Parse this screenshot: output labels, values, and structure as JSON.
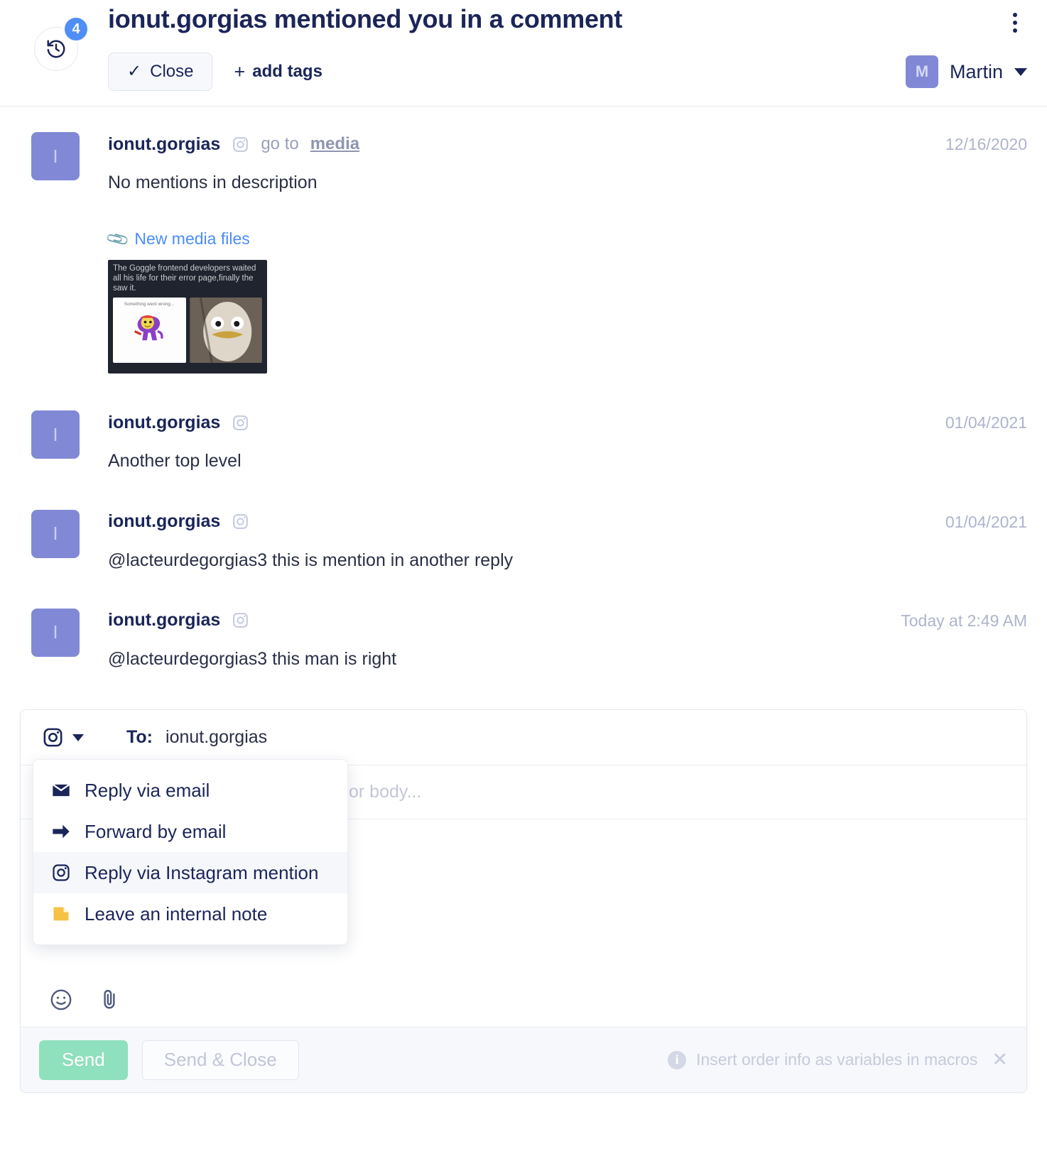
{
  "header": {
    "title": "ionut.gorgias mentioned you in a comment",
    "history_badge": "4",
    "history_icon": "history-clock-icon",
    "close_label": "Close",
    "close_check": "✓",
    "add_tags_label": "add tags",
    "add_tags_plus": "+",
    "kebab_icon": "more-vertical-icon",
    "user": {
      "initial": "M",
      "name": "Martin"
    }
  },
  "thread": {
    "messages": [
      {
        "avatar_initial": "I",
        "author": "ionut.gorgias",
        "channel_icon": "instagram-icon",
        "goto_prefix": "go to",
        "goto_link": "media",
        "time": "12/16/2020",
        "text": "No mentions in description",
        "attachment": {
          "label": "New media files",
          "icon": "paperclip-icon",
          "caption": "The Goggle frontend developers waited all his life for their error page,finally the saw it.",
          "left_pane_caption": "Something went wrong..."
        }
      },
      {
        "avatar_initial": "I",
        "author": "ionut.gorgias",
        "channel_icon": "instagram-icon",
        "time": "01/04/2021",
        "text": "Another top level"
      },
      {
        "avatar_initial": "I",
        "author": "ionut.gorgias",
        "channel_icon": "instagram-icon",
        "time": "01/04/2021",
        "text": "@lacteurdegorgias3 this is mention in another reply"
      },
      {
        "avatar_initial": "I",
        "author": "ionut.gorgias",
        "channel_icon": "instagram-icon",
        "time": "Today at 2:49 AM",
        "text": "@lacteurdegorgias3 this man is right"
      }
    ]
  },
  "composer": {
    "channel_icon": "instagram-icon",
    "to_label": "To:",
    "to_value": "ionut.gorgias",
    "subject_placeholder": "or body...",
    "emoji_icon": "emoji-smile-icon",
    "attach_icon": "paperclip-icon",
    "send_label": "Send",
    "send_close_label": "Send & Close",
    "footer_note": "Insert order info as variables in macros",
    "footer_note_icon": "info-icon",
    "footer_close_icon": "close-x-icon"
  },
  "dropdown": {
    "items": [
      {
        "label": "Reply via email",
        "icon": "envelope-icon",
        "selected": false
      },
      {
        "label": "Forward by email",
        "icon": "arrow-right-icon",
        "selected": false
      },
      {
        "label": "Reply via Instagram mention",
        "icon": "instagram-icon",
        "selected": true
      },
      {
        "label": "Leave an internal note",
        "icon": "note-icon",
        "selected": false
      }
    ]
  },
  "colors": {
    "accent_blue": "#4f8ef7",
    "navy": "#1b2559",
    "avatar_purple": "#8189d6",
    "send_green": "#8fe0bc",
    "note_yellow": "#f5c244"
  }
}
